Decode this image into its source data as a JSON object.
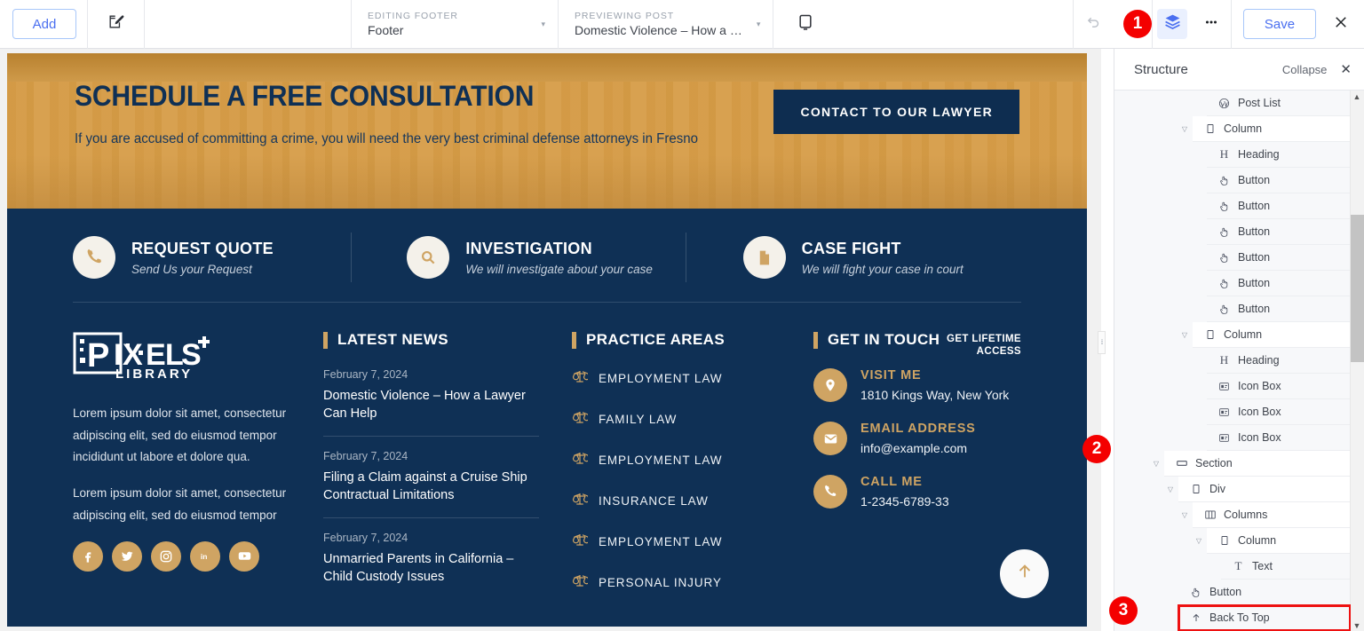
{
  "toolbar": {
    "add_label": "Add",
    "edit_icon": "edit-pencil-square-icon",
    "editing": {
      "label": "EDITING FOOTER",
      "value": "Footer",
      "caret": "▾"
    },
    "previewing": {
      "label": "PREVIEWING POST",
      "value": "Domestic Violence – How a …",
      "caret": "▾"
    },
    "device_icon": "desktop-monitor-icon",
    "undo_icon": "undo-arrow-icon",
    "redo_icon": "redo-arrow-icon",
    "layers_icon": "layers-structure-icon",
    "more_icon": "more-horizontal-icon",
    "save_label": "Save",
    "close_icon": "close-x-icon"
  },
  "badges": {
    "one": "1",
    "two": "2",
    "three": "3"
  },
  "preview": {
    "hero": {
      "title": "SCHEDULE A FREE CONSULTATION",
      "subtitle": "If you are accused of committing a crime, you will need the very best criminal defense attorneys in Fresno",
      "button": "CONTACT TO OUR LAWYER"
    },
    "services": [
      {
        "icon": "phone-icon",
        "title": "REQUEST QUOTE",
        "subtitle": "Send Us your Request"
      },
      {
        "icon": "search-icon",
        "title": "INVESTIGATION",
        "subtitle": "We will investigate about your case"
      },
      {
        "icon": "document-icon",
        "title": "CASE FIGHT",
        "subtitle": "We will fight your case in court"
      }
    ],
    "about": {
      "logo_text_main": "PIXELS",
      "logo_text_sub": "LIBRARY",
      "paragraph_1": "Lorem ipsum dolor sit amet, consectetur adipiscing elit, sed do eiusmod tempor incididunt ut labore et dolore qua.",
      "paragraph_2": "Lorem ipsum dolor sit amet, consectetur adipiscing elit, sed do eiusmod tempor",
      "socials": [
        "facebook-icon",
        "twitter-icon",
        "instagram-icon",
        "linkedin-icon",
        "youtube-icon"
      ]
    },
    "latest_news": {
      "title": "LATEST NEWS",
      "items": [
        {
          "date": "February 7, 2024",
          "title": "Domestic Violence – How a Lawyer Can Help"
        },
        {
          "date": "February 7, 2024",
          "title": "Filing a Claim against a Cruise Ship Contractual Limitations"
        },
        {
          "date": "February 7, 2024",
          "title": "Unmarried Parents in California – Child Custody Issues"
        }
      ]
    },
    "practice_areas": {
      "title": "PRACTICE AREAS",
      "items": [
        "EMPLOYMENT LAW",
        "FAMILY LAW",
        "EMPLOYMENT LAW",
        "INSURANCE LAW",
        "EMPLOYMENT LAW",
        "PERSONAL INJURY"
      ]
    },
    "get_in_touch": {
      "title": "GET IN TOUCH",
      "lifetime_badge": "GET LIFETIME ACCESS",
      "items": [
        {
          "icon": "map-pin-icon",
          "label": "VISIT ME",
          "value": "1810 Kings Way, New York"
        },
        {
          "icon": "envelope-icon",
          "label": "EMAIL ADDRESS",
          "value": "info@example.com"
        },
        {
          "icon": "phone-icon",
          "label": "CALL ME",
          "value": "1-2345-6789-33"
        }
      ]
    },
    "back_to_top_icon": "arrow-up-icon"
  },
  "panel": {
    "title": "Structure",
    "collapse_label": "Collapse",
    "close_icon": "close-x-icon",
    "rows": [
      {
        "label": "Post List",
        "icon": "wordpress-icon",
        "indent": 3,
        "caret": false,
        "selected": false,
        "highlight": false
      },
      {
        "label": "Column",
        "icon": "column-icon",
        "indent": 2,
        "caret": true,
        "selected": true,
        "highlight": false
      },
      {
        "label": "Heading",
        "icon": "heading-icon",
        "indent": 3,
        "caret": false,
        "selected": false,
        "highlight": false
      },
      {
        "label": "Button",
        "icon": "button-icon",
        "indent": 3,
        "caret": false,
        "selected": false,
        "highlight": false
      },
      {
        "label": "Button",
        "icon": "button-icon",
        "indent": 3,
        "caret": false,
        "selected": false,
        "highlight": false
      },
      {
        "label": "Button",
        "icon": "button-icon",
        "indent": 3,
        "caret": false,
        "selected": false,
        "highlight": false
      },
      {
        "label": "Button",
        "icon": "button-icon",
        "indent": 3,
        "caret": false,
        "selected": false,
        "highlight": false
      },
      {
        "label": "Button",
        "icon": "button-icon",
        "indent": 3,
        "caret": false,
        "selected": false,
        "highlight": false
      },
      {
        "label": "Button",
        "icon": "button-icon",
        "indent": 3,
        "caret": false,
        "selected": false,
        "highlight": false
      },
      {
        "label": "Column",
        "icon": "column-icon",
        "indent": 2,
        "caret": true,
        "selected": true,
        "highlight": false
      },
      {
        "label": "Heading",
        "icon": "heading-icon",
        "indent": 3,
        "caret": false,
        "selected": false,
        "highlight": false
      },
      {
        "label": "Icon Box",
        "icon": "icon-box-icon",
        "indent": 3,
        "caret": false,
        "selected": false,
        "highlight": false
      },
      {
        "label": "Icon Box",
        "icon": "icon-box-icon",
        "indent": 3,
        "caret": false,
        "selected": false,
        "highlight": false
      },
      {
        "label": "Icon Box",
        "icon": "icon-box-icon",
        "indent": 3,
        "caret": false,
        "selected": false,
        "highlight": false
      },
      {
        "label": "Section",
        "icon": "section-icon",
        "indent": 0,
        "caret": true,
        "selected": true,
        "highlight": false
      },
      {
        "label": "Div",
        "icon": "div-icon",
        "indent": 1,
        "caret": true,
        "selected": true,
        "highlight": false
      },
      {
        "label": "Columns",
        "icon": "columns-icon",
        "indent": 2,
        "caret": true,
        "selected": true,
        "highlight": false
      },
      {
        "label": "Column",
        "icon": "column-icon",
        "indent": 3,
        "caret": true,
        "selected": true,
        "highlight": false
      },
      {
        "label": "Text",
        "icon": "text-icon",
        "indent": 4,
        "caret": false,
        "selected": false,
        "highlight": false
      },
      {
        "label": "Button",
        "icon": "button-icon",
        "indent": 1,
        "caret": false,
        "selected": false,
        "highlight": false
      },
      {
        "label": "Back To Top",
        "icon": "arrow-up-icon",
        "indent": 1,
        "caret": false,
        "selected": false,
        "highlight": true
      }
    ]
  },
  "colors": {
    "footer_bg": "#0f3055",
    "gold": "#cfa463",
    "hero_bg": "#d9a253",
    "accent_blue": "#4a6ff0",
    "badge_red": "#f40000"
  }
}
